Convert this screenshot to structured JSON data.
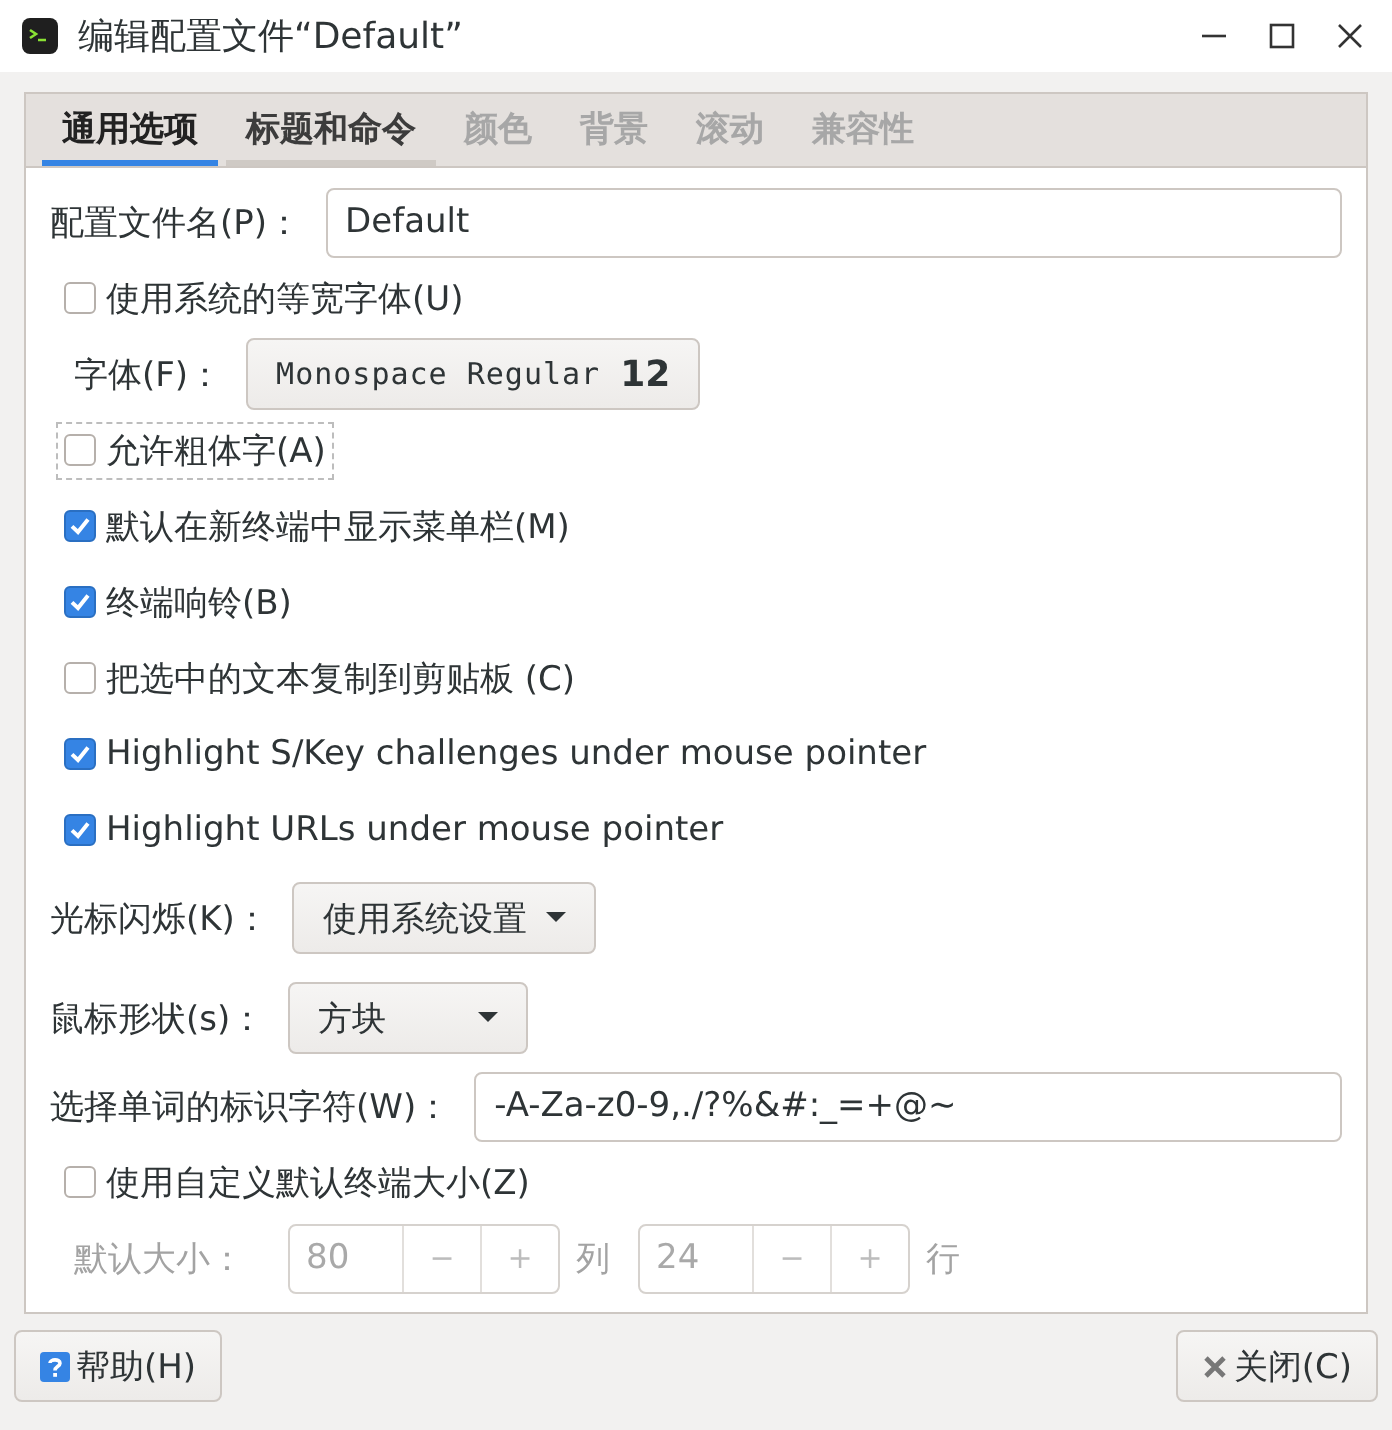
{
  "window": {
    "title": "编辑配置文件“Default”"
  },
  "tabs": [
    {
      "label": "通用选项",
      "selected": true,
      "disabled": false
    },
    {
      "label": "标题和命令",
      "selected": false,
      "disabled": false
    },
    {
      "label": "颜色",
      "selected": false,
      "disabled": true
    },
    {
      "label": "背景",
      "selected": false,
      "disabled": true
    },
    {
      "label": "滚动",
      "selected": false,
      "disabled": true
    },
    {
      "label": "兼容性",
      "selected": false,
      "disabled": true
    }
  ],
  "rows": [
    {
      "kind": "field",
      "label": "配置文件名(P)：",
      "value": "Default"
    },
    {
      "kind": "checkbox",
      "label": "使用系统的等宽字体(U)",
      "checked": false,
      "focused": false
    },
    {
      "kind": "font",
      "label": "字体(F)：",
      "font_name": "Monospace Regular",
      "font_size": "12"
    },
    {
      "kind": "checkbox",
      "label": "允许粗体字(A)",
      "checked": false,
      "focused": true
    },
    {
      "kind": "checkbox",
      "label": "默认在新终端中显示菜单栏(M)",
      "checked": true,
      "focused": false
    },
    {
      "kind": "checkbox",
      "label": "终端响铃(B)",
      "checked": true,
      "focused": false
    },
    {
      "kind": "checkbox",
      "label": "把选中的文本复制到剪贴板 (C)",
      "checked": false,
      "focused": false
    },
    {
      "kind": "checkbox",
      "label": "Highlight S/Key challenges under mouse pointer",
      "checked": true,
      "focused": false
    },
    {
      "kind": "checkbox",
      "label": "Highlight URLs under mouse pointer",
      "checked": true,
      "focused": false
    },
    {
      "kind": "dropdown",
      "label": "光标闪烁(K)：",
      "value": "使用系统设置"
    },
    {
      "kind": "dropdown",
      "label": "鼠标形状(s)：",
      "value": "方块"
    },
    {
      "kind": "field",
      "label": "选择单词的标识字符(W)：",
      "value": "-A-Za-z0-9,./?%&#:_=+@~"
    },
    {
      "kind": "checkbox",
      "label": "使用自定义默认终端大小(Z)",
      "checked": false,
      "focused": false
    },
    {
      "kind": "size",
      "label": "默认大小：",
      "disabled": true,
      "spins": [
        {
          "value": "80",
          "minus": "−",
          "plus": "+",
          "unit": "列"
        },
        {
          "value": "24",
          "minus": "−",
          "plus": "+",
          "unit": "行"
        }
      ]
    }
  ],
  "buttons": [
    {
      "kind": "help",
      "label": "帮助(H)"
    },
    {
      "kind": "close",
      "label": "关闭(C)"
    }
  ]
}
